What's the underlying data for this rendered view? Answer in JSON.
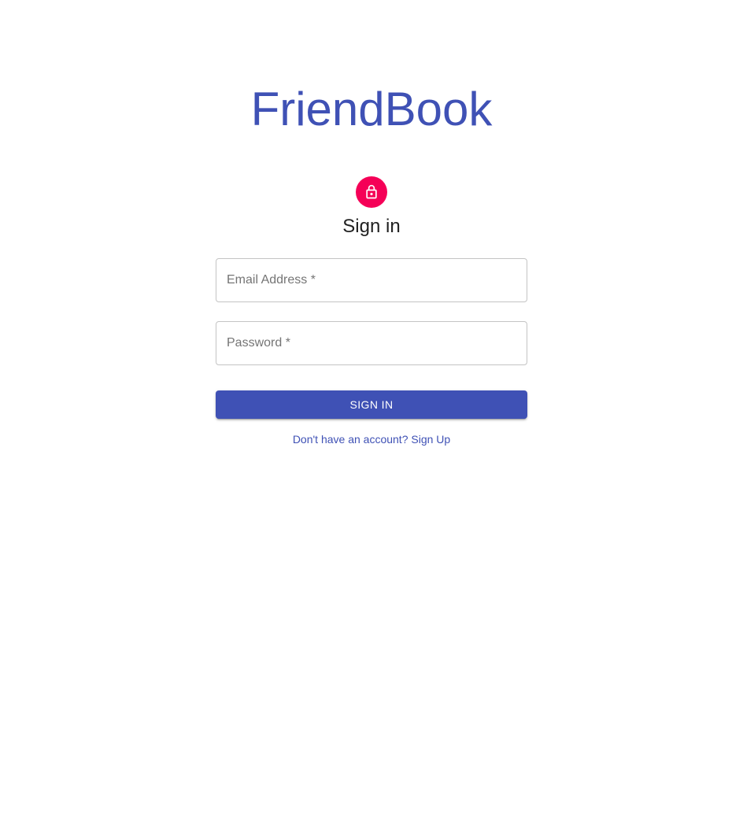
{
  "app": {
    "title": "FriendBook",
    "brand_color": "#3f51b5",
    "accent_color": "#f50057"
  },
  "form": {
    "avatar_icon": "lock-outline-icon",
    "heading": "Sign in",
    "email": {
      "label": "Email Address *",
      "value": ""
    },
    "password": {
      "label": "Password *",
      "value": ""
    },
    "submit_label": "SIGN IN",
    "signup_link": "Don't have an account? Sign Up"
  }
}
